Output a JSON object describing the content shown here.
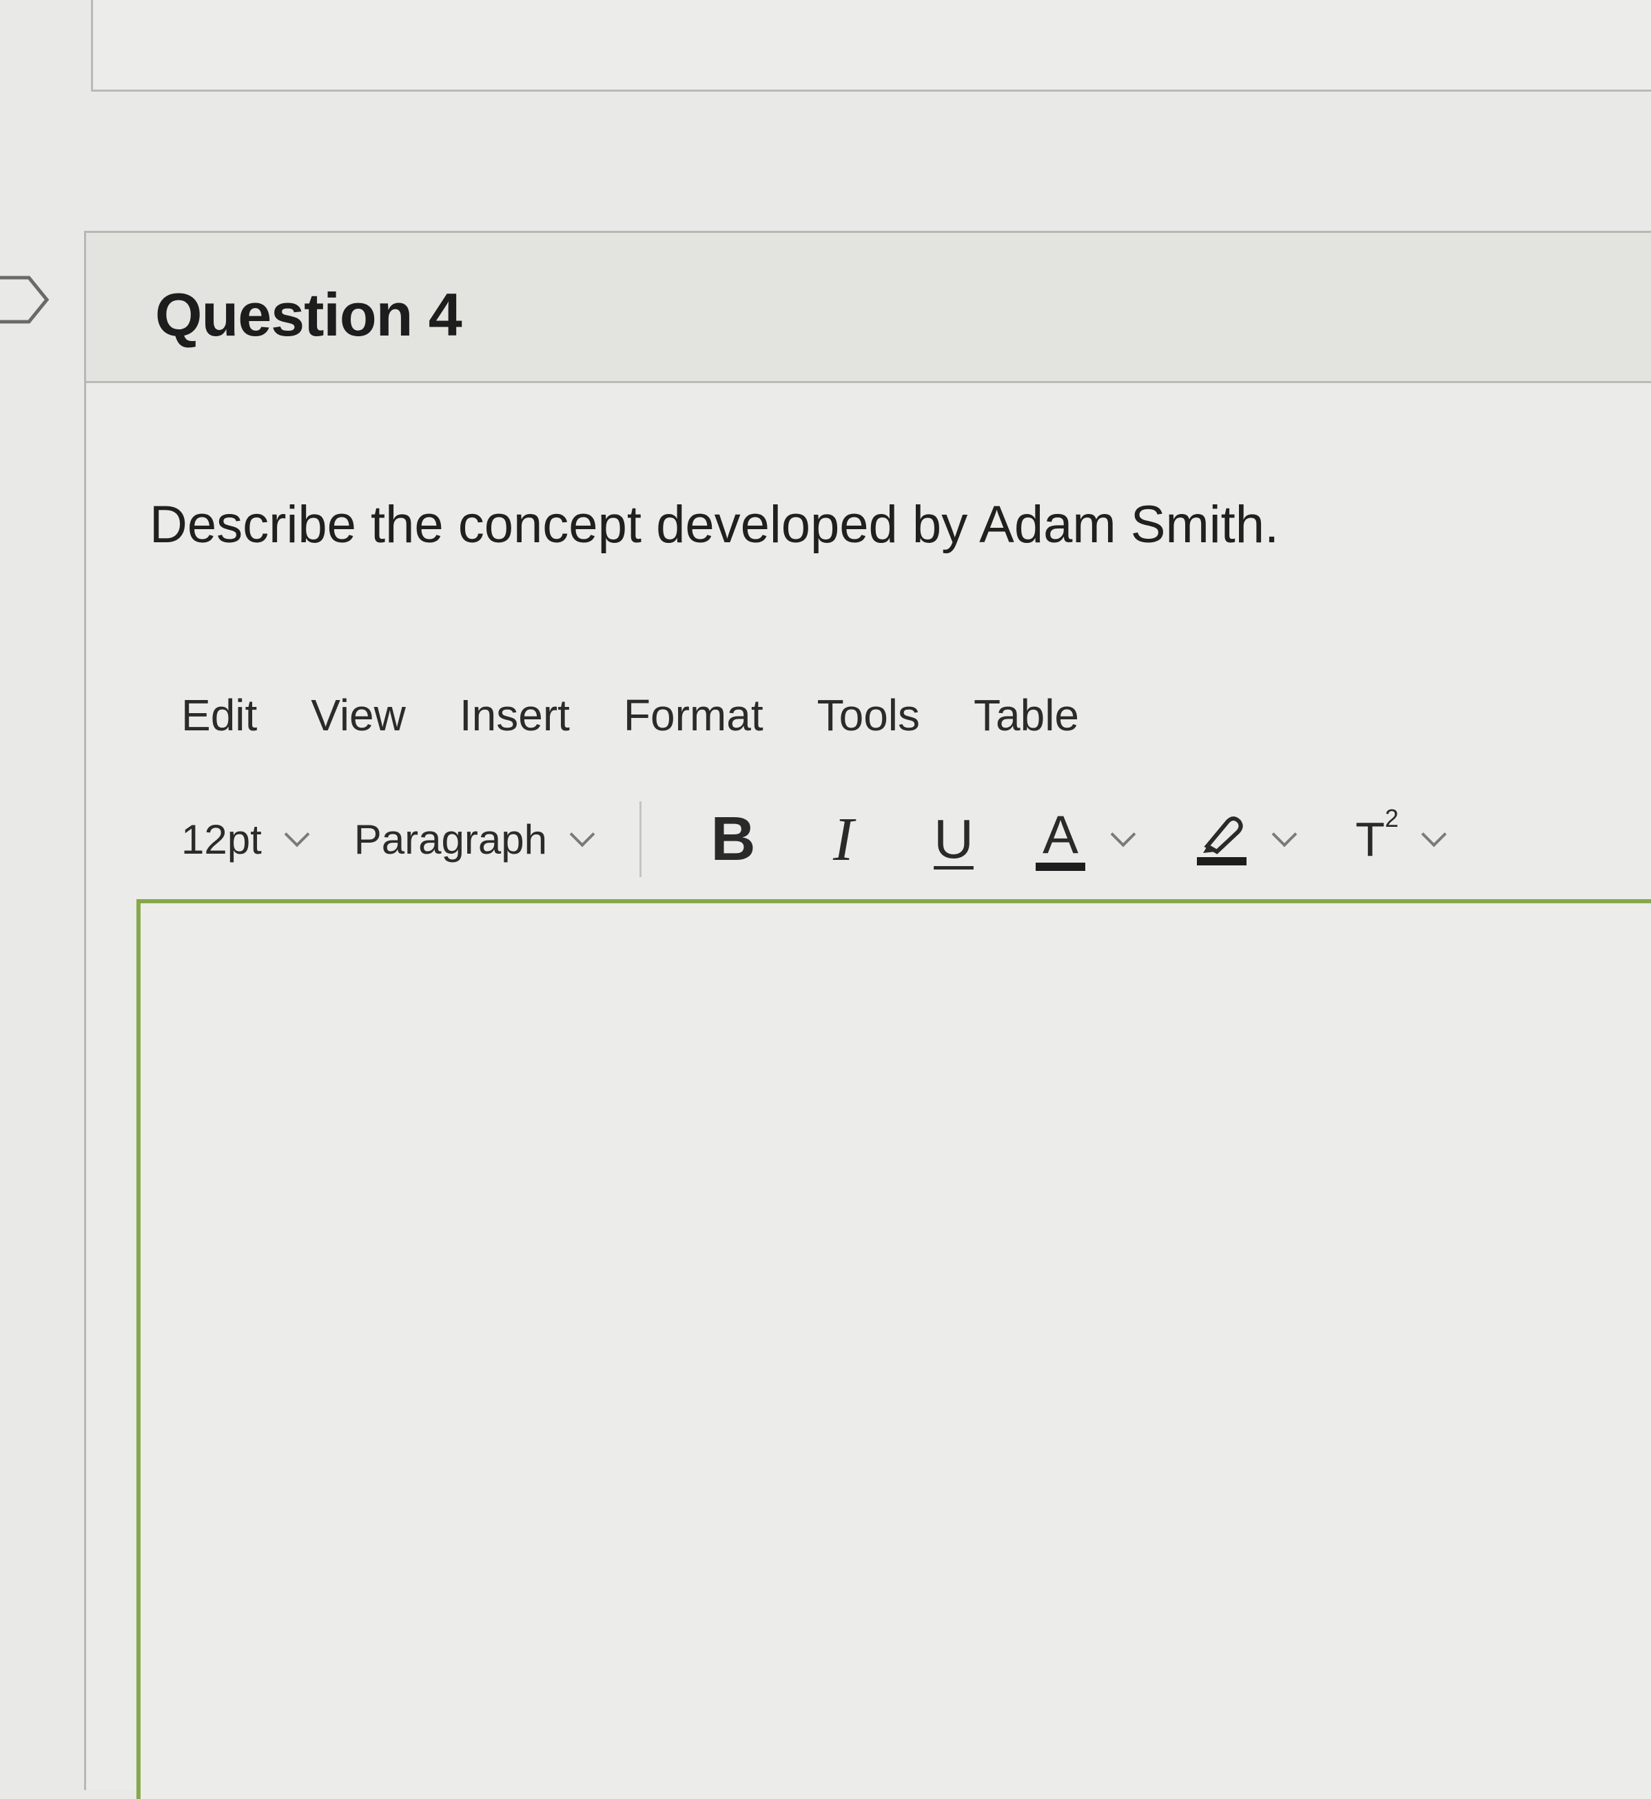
{
  "question": {
    "title": "Question 4",
    "prompt": "Describe the concept developed by Adam Smith."
  },
  "editor": {
    "menubar": [
      "Edit",
      "View",
      "Insert",
      "Format",
      "Tools",
      "Table"
    ],
    "toolbar": {
      "font_size": "12pt",
      "block_format": "Paragraph",
      "bold_label": "B",
      "italic_label": "I",
      "underline_label": "U",
      "font_color_label": "A",
      "superscript_label": "T",
      "superscript_exp": "2"
    },
    "content": "",
    "focus_border_color": "#85a84a"
  },
  "icons": {
    "flag": "flag-outline-icon",
    "chevron": "chevron-down-icon",
    "highlight": "highlighter-icon"
  },
  "colors": {
    "accent": "#85a84a",
    "complete_indicator": "#5f8f3a"
  }
}
